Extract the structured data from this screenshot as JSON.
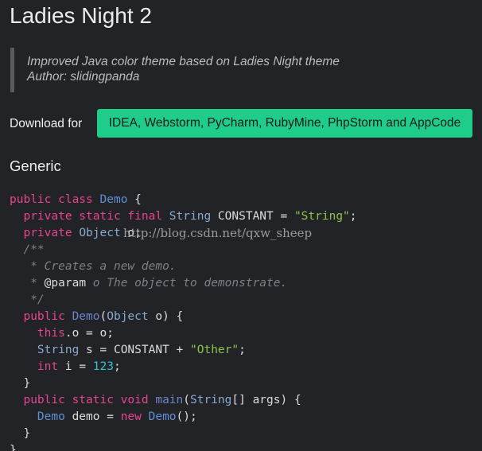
{
  "page": {
    "title": "Ladies Night 2",
    "description": "Improved Java color theme based on Ladies Night theme",
    "author": "Author: slidingpanda"
  },
  "download": {
    "label": "Download for",
    "button_label": "IDEA, Webstorm, PyCharm, RubyMine, PhpStorm and AppCode",
    "button_color": "#1ecd8a"
  },
  "section": {
    "heading": "Generic"
  },
  "watermark": "http://blog.csdn.net/qxw_sheep",
  "colors": {
    "background": "#222326",
    "keyword": "#e6458f",
    "class_name": "#5f8fd4",
    "type": "#8aa9cf",
    "string": "#8ec34a",
    "number": "#30c6d1",
    "comment": "#7f7f85",
    "plain": "#dcdcdc"
  },
  "code_lines": [
    [
      [
        "kw",
        "public class "
      ],
      [
        "cls",
        "Demo"
      ],
      [
        "plain",
        " {"
      ]
    ],
    [
      [
        "plain",
        "  "
      ],
      [
        "kw",
        "private static final "
      ],
      [
        "type",
        "String"
      ],
      [
        "plain",
        " CONSTANT = "
      ],
      [
        "str",
        "\"String\""
      ],
      [
        "plain",
        ";"
      ]
    ],
    [
      [
        "plain",
        "  "
      ],
      [
        "kw",
        "private "
      ],
      [
        "type",
        "Object"
      ],
      [
        "plain",
        " o;"
      ]
    ],
    [
      [
        "plain",
        "  "
      ],
      [
        "com",
        "/**"
      ]
    ],
    [
      [
        "plain",
        "   "
      ],
      [
        "com",
        "* Creates a new demo."
      ]
    ],
    [
      [
        "plain",
        "   "
      ],
      [
        "com",
        "* "
      ],
      [
        "plain",
        "@param"
      ],
      [
        "com",
        " o The object to demonstrate."
      ]
    ],
    [
      [
        "plain",
        "   "
      ],
      [
        "com",
        "*/"
      ]
    ],
    [
      [
        "plain",
        "  "
      ],
      [
        "kw",
        "public "
      ],
      [
        "fn",
        "Demo"
      ],
      [
        "plain",
        "("
      ],
      [
        "type",
        "Object"
      ],
      [
        "plain",
        " o) {"
      ]
    ],
    [
      [
        "plain",
        "    "
      ],
      [
        "kw",
        "this"
      ],
      [
        "plain",
        ".o = o;"
      ]
    ],
    [
      [
        "plain",
        "    "
      ],
      [
        "type",
        "String"
      ],
      [
        "plain",
        " s = CONSTANT + "
      ],
      [
        "str",
        "\"Other\""
      ],
      [
        "plain",
        ";"
      ]
    ],
    [
      [
        "plain",
        "    "
      ],
      [
        "kw",
        "int"
      ],
      [
        "plain",
        " i = "
      ],
      [
        "num",
        "123"
      ],
      [
        "plain",
        ";"
      ]
    ],
    [
      [
        "plain",
        "  }"
      ]
    ],
    [
      [
        "plain",
        "  "
      ],
      [
        "kw",
        "public static void "
      ],
      [
        "fn",
        "main"
      ],
      [
        "plain",
        "("
      ],
      [
        "type",
        "String"
      ],
      [
        "plain",
        "[] args) {"
      ]
    ],
    [
      [
        "plain",
        "    "
      ],
      [
        "cls",
        "Demo"
      ],
      [
        "plain",
        " demo = "
      ],
      [
        "kw",
        "new "
      ],
      [
        "cls",
        "Demo"
      ],
      [
        "plain",
        "();"
      ]
    ],
    [
      [
        "plain",
        "  }"
      ]
    ],
    [
      [
        "plain",
        "}"
      ]
    ]
  ]
}
